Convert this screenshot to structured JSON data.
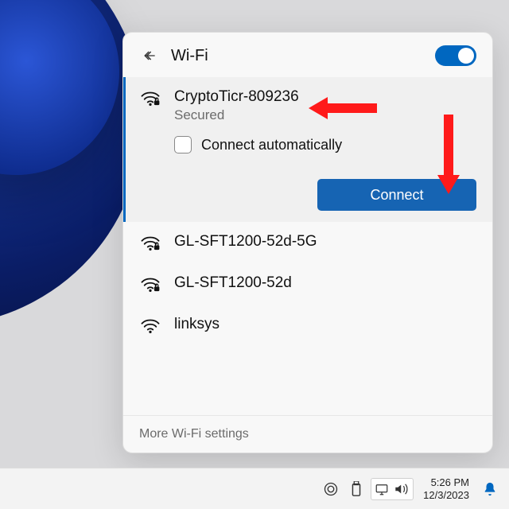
{
  "header": {
    "title": "Wi-Fi",
    "toggle_on": true
  },
  "selected_network": {
    "ssid": "CryptoTicr-809236",
    "security": "Secured",
    "auto_connect_label": "Connect automatically",
    "connect_label": "Connect"
  },
  "networks": [
    {
      "ssid": "GL-SFT1200-52d-5G",
      "secured": true
    },
    {
      "ssid": "GL-SFT1200-52d",
      "secured": true
    },
    {
      "ssid": "linksys",
      "secured": false
    }
  ],
  "more_settings_label": "More Wi-Fi settings",
  "taskbar": {
    "time": "5:26 PM",
    "date": "12/3/2023"
  },
  "icons": {
    "back": "back-arrow-icon",
    "wifi_secured": "wifi-lock-icon",
    "wifi_open": "wifi-icon",
    "cloud": "creative-cloud-icon",
    "usb": "usb-eject-icon",
    "net": "network-tray-icon",
    "volume": "volume-icon",
    "bell": "notification-bell-icon"
  },
  "colors": {
    "accent": "#0067c0",
    "arrow": "#ff1a1a"
  }
}
